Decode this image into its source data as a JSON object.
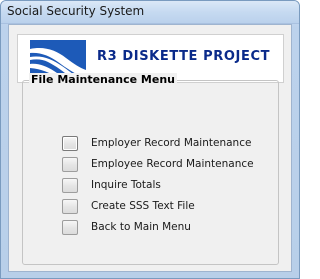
{
  "window": {
    "title": "Social Security System"
  },
  "banner": {
    "title": "R3 DISKETTE PROJECT",
    "logo_icon": "sss-logo-icon"
  },
  "menu_group": {
    "legend": "File Maintenance Menu",
    "items": [
      {
        "label": "Employer Record Maintenance"
      },
      {
        "label": "Employee Record Maintenance"
      },
      {
        "label": "Inquire Totals"
      },
      {
        "label": "Create SSS Text File"
      },
      {
        "label": "Back to Main Menu"
      }
    ]
  },
  "colors": {
    "banner_text": "#0a2a8a",
    "logo_blue": "#1d5ab8",
    "window_frame": "#bcd2ec",
    "client_bg": "#f0f0f0"
  }
}
